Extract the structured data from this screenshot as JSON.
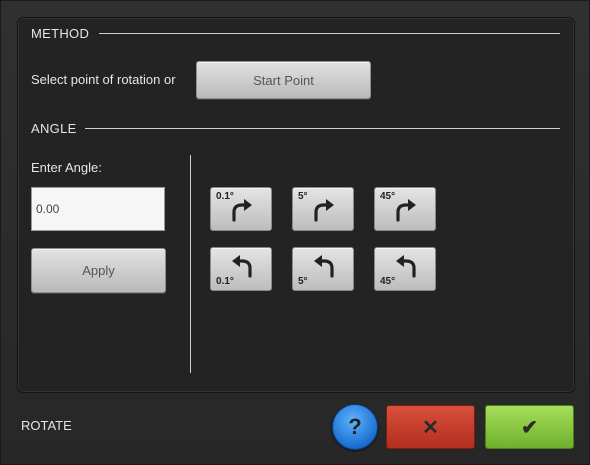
{
  "method": {
    "heading": "METHOD",
    "prompt": "Select point of rotation or",
    "start_point_label": "Start Point"
  },
  "angle": {
    "heading": "ANGLE",
    "enter_label": "Enter Angle:",
    "input_value": "0.00",
    "apply_label": "Apply",
    "clockwise": [
      {
        "label": "0.1°",
        "icon": "rotate-cw-icon"
      },
      {
        "label": "5°",
        "icon": "rotate-cw-icon"
      },
      {
        "label": "45°",
        "icon": "rotate-cw-icon"
      }
    ],
    "counterclockwise": [
      {
        "label": "0.1°",
        "icon": "rotate-ccw-icon"
      },
      {
        "label": "5°",
        "icon": "rotate-ccw-icon"
      },
      {
        "label": "45°",
        "icon": "rotate-ccw-icon"
      }
    ]
  },
  "footer": {
    "title": "ROTATE",
    "help_symbol": "?",
    "cancel_symbol": "✕",
    "ok_symbol": "✔"
  },
  "colors": {
    "cancel": "#c03a28",
    "ok": "#8cc943",
    "help": "#1f7ad8"
  }
}
